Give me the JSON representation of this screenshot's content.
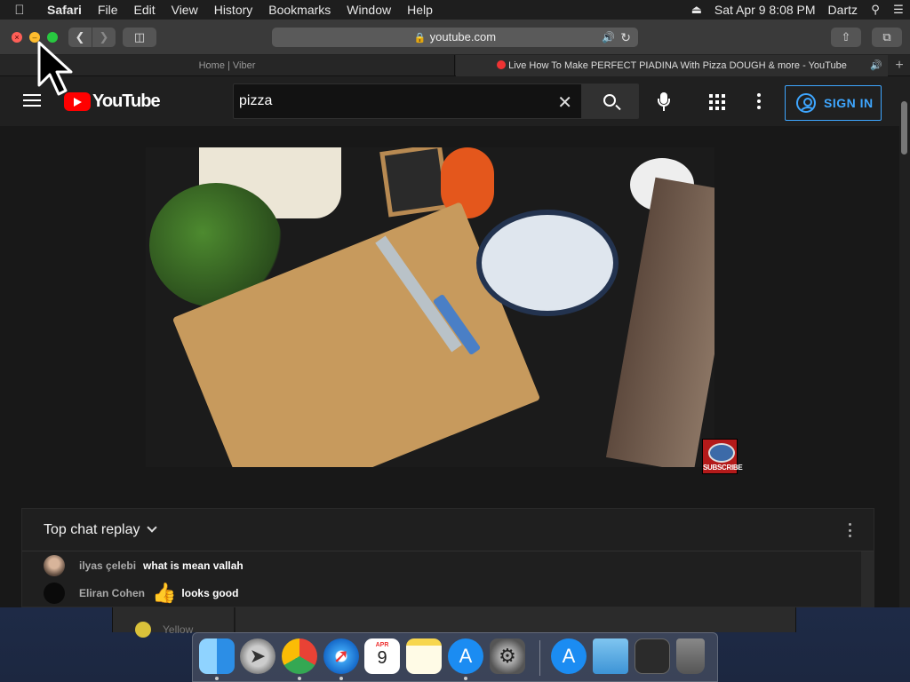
{
  "menubar": {
    "apple": "",
    "app": "Safari",
    "items": [
      "File",
      "Edit",
      "View",
      "History",
      "Bookmarks",
      "Window",
      "Help"
    ],
    "clock": "Sat Apr 9  8:08 PM",
    "user": "Dartz"
  },
  "safari": {
    "url": "youtube.com",
    "tabs": [
      {
        "title": "Home | Viber"
      },
      {
        "title": "Live How To Make PERFECT PIADINA With Pizza DOUGH & more - YouTube"
      }
    ],
    "new_tab": "+"
  },
  "youtube": {
    "logo_text": "YouTube",
    "search": {
      "value": "pizza",
      "placeholder": "Search"
    },
    "sign_in": "SIGN IN",
    "subscribe_badge": "SUBSCRIBE",
    "chat": {
      "title": "Top chat replay",
      "messages": [
        {
          "author": "ilyas çelebi",
          "text": "what is mean vallah"
        },
        {
          "author": "Eliran Cohen",
          "emoji": "👍",
          "text": "looks good"
        }
      ]
    }
  },
  "background_window": {
    "label": "Yellow"
  },
  "dock": {
    "items": [
      "finder-icon",
      "launchpad-icon",
      "chrome-icon",
      "safari-icon",
      "calendar-icon",
      "notes-icon",
      "app-store-icon",
      "system-preferences-icon",
      "app-store-downloads-icon",
      "downloads-folder-icon",
      "chrome-app-icon",
      "trash-icon"
    ],
    "calendar_month": "APR",
    "calendar_day": "9"
  },
  "colors": {
    "yt_red": "#ff0000",
    "yt_blue": "#3ea6ff",
    "traffic_close": "#fe5f57",
    "traffic_min": "#febc2e",
    "traffic_max": "#28c840"
  }
}
